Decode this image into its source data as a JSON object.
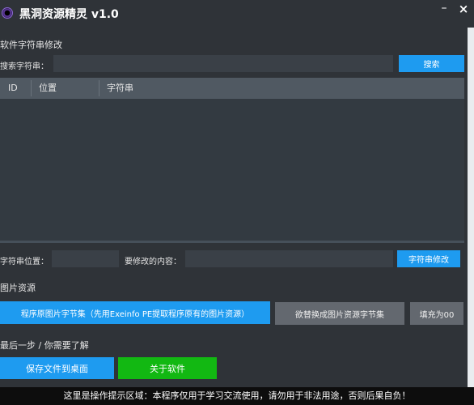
{
  "window": {
    "title": "黑洞资源精灵 v1.0",
    "minimize_glyph": "–",
    "close_glyph": "×"
  },
  "strings_section": {
    "title": "软件字符串修改",
    "search_label": "搜索字符串：",
    "search_value": "",
    "search_button": "搜索",
    "table": {
      "columns": [
        "ID",
        "位置",
        "字符串"
      ],
      "rows": []
    },
    "position_label": "字符串位置：",
    "position_value": "",
    "modify_label": "要修改的内容：",
    "modify_value": "",
    "modify_button": "字符串修改"
  },
  "image_section": {
    "title": "图片资源",
    "extract_button": "程序原图片字节集（先用Exeinfo PE提取程序原有的图片资源）",
    "replace_button": "欲替换成图片资源字节集",
    "fill_button": "填充为00"
  },
  "final_section": {
    "title": "最后一步 / 你需要了解",
    "save_button": "保存文件到桌面",
    "about_button": "关于软件"
  },
  "footer": {
    "text": "这里是操作提示区域：本程序仅用于学习交流使用，请勿用于非法用途，否则后果自负！"
  },
  "colors": {
    "background": "#2f3338",
    "accent_blue": "#1e9bf0",
    "accent_green": "#12b812",
    "button_gray": "#63686f",
    "table_header": "#505962",
    "footer_bg": "#0d0d0d"
  },
  "icons": {
    "app": "black-hole-icon"
  }
}
